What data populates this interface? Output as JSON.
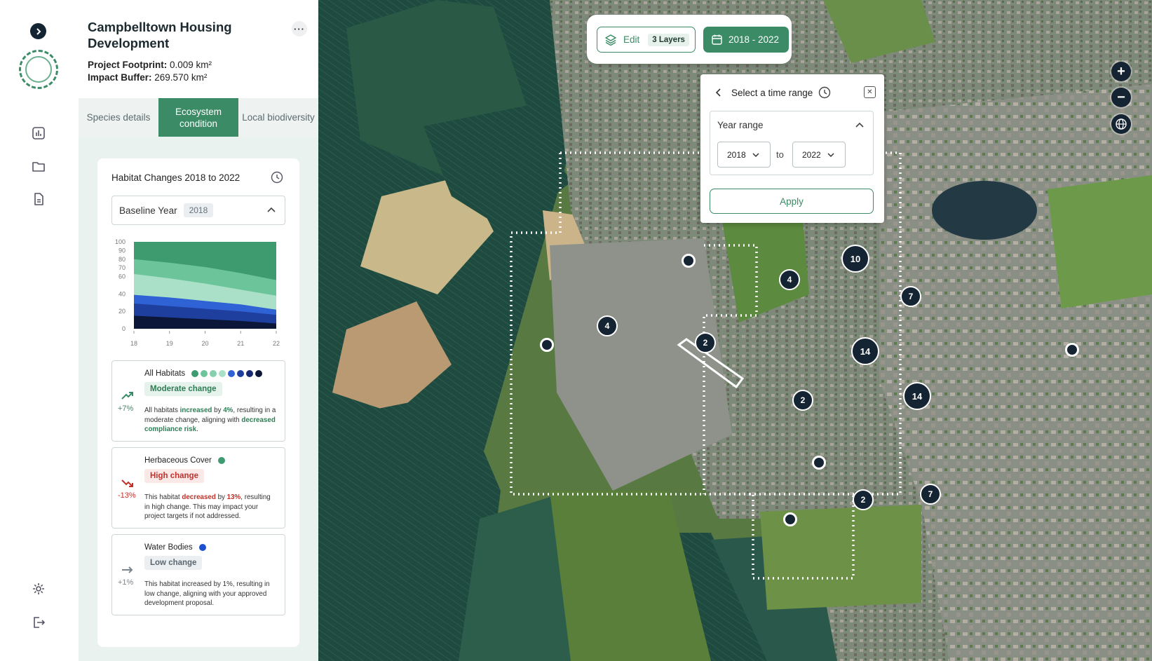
{
  "project": {
    "title": "Campbelltown Housing Development",
    "footprint_label": "Project Footprint:",
    "footprint_value": "0.009 km²",
    "buffer_label": "Impact Buffer:",
    "buffer_value": "269.570 km²"
  },
  "tabs": [
    {
      "label": "Species details"
    },
    {
      "label": "Ecosystem condition",
      "active": true
    },
    {
      "label": "Local biodiversity"
    }
  ],
  "habitat_panel": {
    "title": "Habitat Changes 2018 to 2022",
    "baseline_label": "Baseline Year",
    "baseline_value": "2018"
  },
  "chart_data": {
    "type": "area",
    "x": [
      "18",
      "19",
      "20",
      "21",
      "22"
    ],
    "ylim": [
      0,
      100
    ],
    "y_ticks": [
      "100",
      "90",
      "80",
      "70",
      "60",
      "40",
      "20",
      "0"
    ],
    "series": [
      {
        "color": "#0b1638",
        "values": [
          15,
          13,
          11,
          9,
          6
        ]
      },
      {
        "color": "#1e3f9e",
        "values": [
          29,
          26,
          23,
          20,
          16
        ]
      },
      {
        "color": "#2f62d4",
        "values": [
          39,
          36,
          32,
          28,
          22
        ]
      },
      {
        "color": "#a9e0c7",
        "values": [
          63,
          58,
          52,
          45,
          38
        ]
      },
      {
        "color": "#6cc49a",
        "values": [
          80,
          76,
          71,
          64,
          56
        ]
      },
      {
        "color": "#3e9b70",
        "values": [
          100,
          100,
          100,
          100,
          100
        ]
      }
    ],
    "grid": false
  },
  "habitats": [
    {
      "name": "All Habitats",
      "badge": "Moderate change",
      "badge_color": "#2e7d55",
      "badge_bg": "#e6f2ec",
      "pct": "+7%",
      "pct_color": "#3b8b66",
      "dots": [
        "#3e9b70",
        "#6cc49a",
        "#86d0ad",
        "#a9e0c7",
        "#2f62d4",
        "#1e3f9e",
        "#152a70",
        "#0b1638"
      ],
      "desc": [
        "All habitats ",
        "increased",
        " by ",
        "4%",
        ", resulting in a moderate change, aligning with ",
        "decreased compliance risk",
        "."
      ],
      "hl_color": "#2e7d55"
    },
    {
      "name": "Herbaceous Cover",
      "badge": "High change",
      "badge_color": "#c0312b",
      "badge_bg": "#fbe9e8",
      "pct": "-13%",
      "pct_color": "#c0312b",
      "dots": [
        "#3e9b70"
      ],
      "desc": [
        "This habitat ",
        "decreased",
        " by ",
        "13%",
        ", resulting in high change. This may impact your project targets if not addressed.",
        "",
        ""
      ],
      "hl_color": "#c0312b"
    },
    {
      "name": "Water Bodies",
      "badge": "Low change",
      "badge_color": "#5b6770",
      "badge_bg": "#eceff1",
      "pct": "+1%",
      "pct_color": "#7a868c",
      "dots": [
        "#1e4fd0"
      ],
      "desc": [
        "This habitat increased by 1%, resulting in low change, aligning with your approved development proposal.",
        "",
        "",
        "",
        "",
        "",
        ""
      ],
      "hl_color": "#333333"
    }
  ],
  "map_toolbar": {
    "edit_label": "Edit",
    "layers_label": "3 Layers",
    "date_range": "2018 - 2022"
  },
  "time_range": {
    "title": "Select a time range",
    "field_label": "Year range",
    "from": "2018",
    "to_label": "to",
    "to": "2022",
    "apply_label": "Apply"
  },
  "markers": [
    {
      "label": "10",
      "size": 40
    },
    {
      "label": "4",
      "size": 30
    },
    {
      "label": "7",
      "size": 30
    },
    {
      "label": "4",
      "size": 30
    },
    {
      "label": "2",
      "size": 30
    },
    {
      "label": "14",
      "size": 40
    },
    {
      "label": "14",
      "size": 40
    },
    {
      "label": "2",
      "size": 30
    },
    {
      "label": "2",
      "size": 30
    },
    {
      "label": "7",
      "size": 30
    }
  ]
}
